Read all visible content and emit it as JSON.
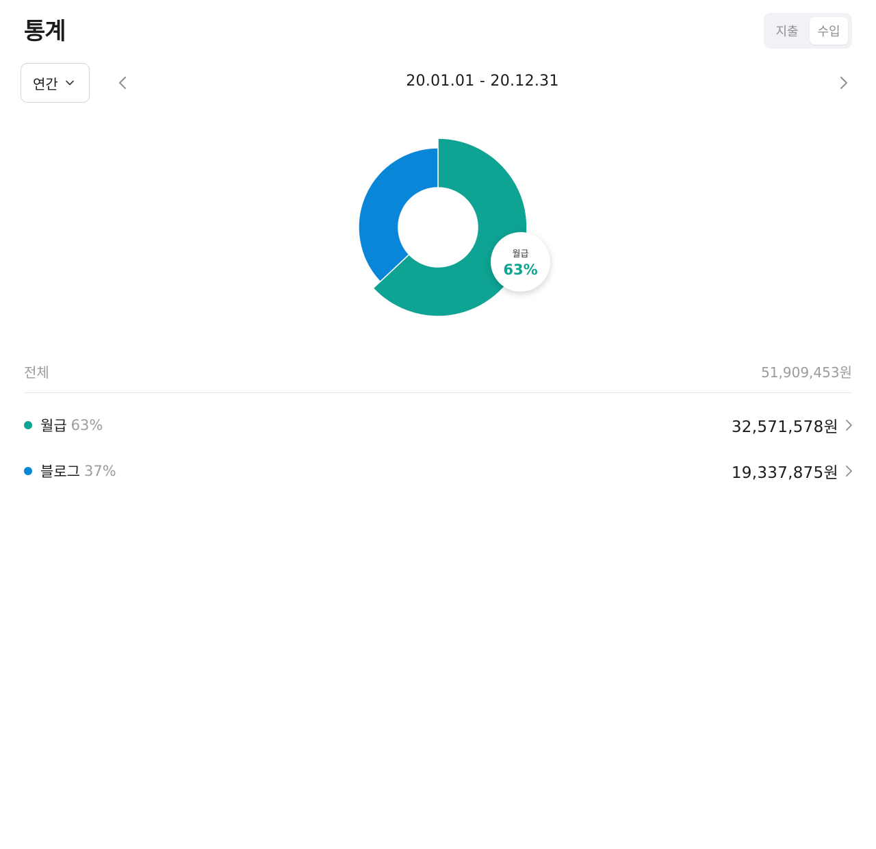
{
  "header": {
    "title": "통계"
  },
  "tabs": {
    "expense_label": "지출",
    "income_label": "수입",
    "active": "income"
  },
  "period": {
    "selected": "연간",
    "range": "20.01.01 - 20.12.31"
  },
  "icons": {
    "prev": "chevron-left-icon",
    "next": "chevron-right-icon",
    "dropdown": "chevron-down-icon",
    "row": "chevron-right-icon"
  },
  "chart_data": {
    "type": "pie",
    "categories": [
      "월급",
      "블로그"
    ],
    "values": [
      63,
      37
    ],
    "colors": [
      "#0ea393",
      "#0a86d8"
    ],
    "highlight": {
      "label": "월급",
      "value": "63%"
    }
  },
  "summary": {
    "total_label": "전체",
    "total_amount": "51,909,453원"
  },
  "categories": [
    {
      "name": "월급",
      "percent": "63%",
      "amount": "32,571,578원",
      "color": "#0ea393"
    },
    {
      "name": "블로그",
      "percent": "37%",
      "amount": "19,337,875원",
      "color": "#0a86d8"
    }
  ]
}
